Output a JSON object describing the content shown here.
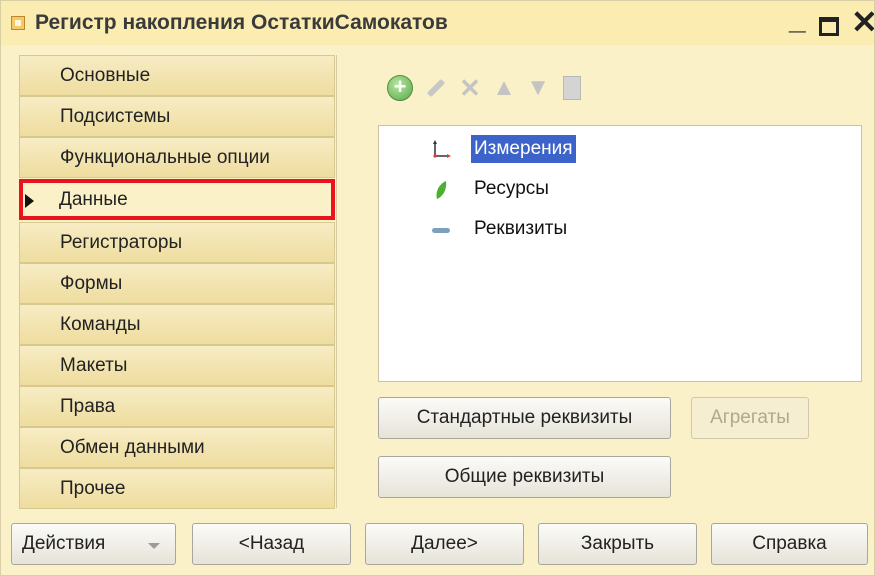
{
  "window": {
    "title": "Регистр накопления ОстаткиСамокатов",
    "minimize_glyph": "_",
    "close_glyph": "✕"
  },
  "nav": {
    "items": [
      {
        "label": "Основные"
      },
      {
        "label": "Подсистемы"
      },
      {
        "label": "Функциональные опции"
      },
      {
        "label": "Данные",
        "active": true
      },
      {
        "label": "Регистраторы"
      },
      {
        "label": "Формы"
      },
      {
        "label": "Команды"
      },
      {
        "label": "Макеты"
      },
      {
        "label": "Права"
      },
      {
        "label": "Обмен данными"
      },
      {
        "label": "Прочее"
      }
    ]
  },
  "toolbar": {
    "icons": [
      "add-icon",
      "edit-icon",
      "delete-icon",
      "move-up-icon",
      "move-down-icon",
      "document-icon"
    ]
  },
  "tree": {
    "items": [
      {
        "label": "Измерения",
        "icon": "dimensions-icon",
        "selected": true
      },
      {
        "label": "Ресурсы",
        "icon": "resources-icon",
        "selected": false
      },
      {
        "label": "Реквизиты",
        "icon": "attributes-icon",
        "selected": false
      }
    ]
  },
  "panel_buttons": {
    "standard_attributes": "Стандартные реквизиты",
    "aggregates": "Агрегаты",
    "common_attributes": "Общие реквизиты"
  },
  "footer": {
    "actions": "Действия",
    "back": "<Назад",
    "next": "Далее>",
    "close": "Закрыть",
    "help": "Справка"
  },
  "colors": {
    "window_bg": "#fbf1c8",
    "selection": "#3b63c9",
    "active_outline": "#e8141b"
  }
}
